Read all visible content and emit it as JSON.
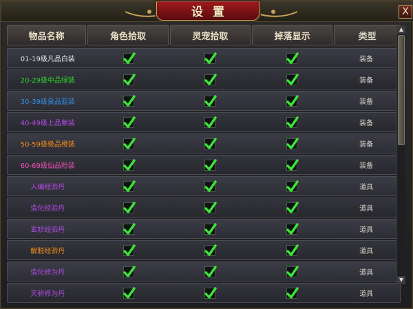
{
  "window": {
    "title": "设置",
    "close_label": "X"
  },
  "columns": [
    "物品名称",
    "角色拾取",
    "灵宠拾取",
    "掉落显示",
    "类型"
  ],
  "rows": [
    {
      "name": "01-19级凡品白装",
      "color": "#e6e6e6",
      "role": true,
      "pet": true,
      "drop": true,
      "type": "装备"
    },
    {
      "name": "20-29级中品绿装",
      "color": "#2bd62b",
      "role": true,
      "pet": true,
      "drop": true,
      "type": "装备"
    },
    {
      "name": "30-39级良品蓝装",
      "color": "#2f8fe0",
      "role": true,
      "pet": true,
      "drop": true,
      "type": "装备"
    },
    {
      "name": "40-49级上品紫装",
      "color": "#b24ae8",
      "role": true,
      "pet": true,
      "drop": true,
      "type": "装备"
    },
    {
      "name": "50-59级极品橙装",
      "color": "#f08a1c",
      "role": true,
      "pet": true,
      "drop": true,
      "type": "装备"
    },
    {
      "name": "60-69级仙品粉装",
      "color": "#f050b6",
      "role": true,
      "pet": true,
      "drop": true,
      "type": "装备"
    },
    {
      "name": "入编经验丹",
      "color": "#b24ae8",
      "role": true,
      "pet": true,
      "drop": true,
      "type": "道具"
    },
    {
      "name": "造化经验丹",
      "color": "#b24ae8",
      "role": true,
      "pet": true,
      "drop": true,
      "type": "道具"
    },
    {
      "name": "玄妙经验丹",
      "color": "#b24ae8",
      "role": true,
      "pet": true,
      "drop": true,
      "type": "道具"
    },
    {
      "name": "解脱经验丹",
      "color": "#f08a1c",
      "role": true,
      "pet": true,
      "drop": true,
      "type": "道具"
    },
    {
      "name": "造化修为丹",
      "color": "#b24ae8",
      "role": true,
      "pet": true,
      "drop": true,
      "type": "道具"
    },
    {
      "name": "天骄修为丹",
      "color": "#b24ae8",
      "role": true,
      "pet": true,
      "drop": true,
      "type": "道具"
    }
  ],
  "icons": {
    "checkbox": "checkmark-icon",
    "scroll_up": "arrow-up-icon",
    "scroll_down": "arrow-down-icon"
  }
}
